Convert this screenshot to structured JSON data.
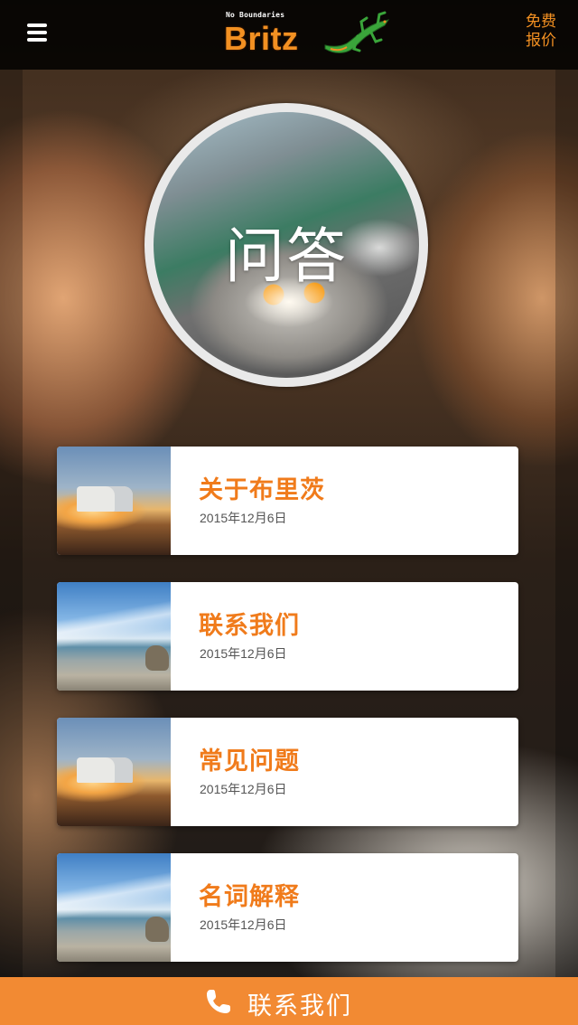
{
  "header": {
    "logo_tagline": "No Boundaries",
    "logo_text": "Britz",
    "quote_line1": "免费",
    "quote_line2": "报价"
  },
  "hero": {
    "title": "问答"
  },
  "articles": [
    {
      "title": "关于布里茨",
      "date": "2015年12月6日",
      "thumb": "sunset"
    },
    {
      "title": "联系我们",
      "date": "2015年12月6日",
      "thumb": "beach"
    },
    {
      "title": "常见问题",
      "date": "2015年12月6日",
      "thumb": "sunset"
    },
    {
      "title": "名词解释",
      "date": "2015年12月6日",
      "thumb": "beach"
    }
  ],
  "bottom_bar": {
    "label": "联系我们",
    "icon": "phone-icon"
  },
  "colors": {
    "accent": "#f28a33",
    "title_orange": "#f07b1b",
    "header_bg": "#000000"
  }
}
